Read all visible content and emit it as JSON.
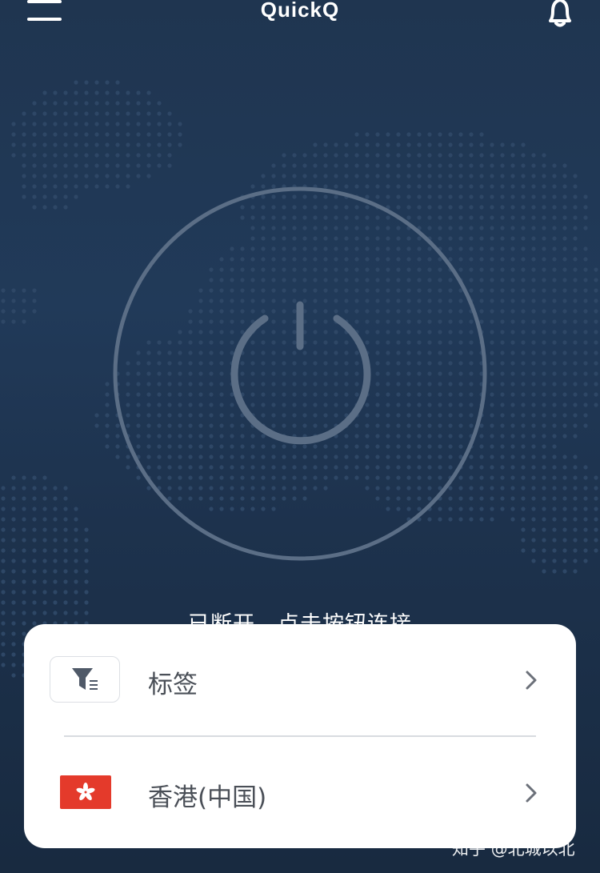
{
  "header": {
    "title": "QuickQ",
    "menu_icon": "hamburger-icon",
    "notification_icon": "bell-icon"
  },
  "main": {
    "power_icon": "power-icon",
    "status_text": "已断开，点击按钮连接"
  },
  "panel": {
    "tag_row": {
      "label": "标签",
      "icon": "filter-icon"
    },
    "region_row": {
      "label": "香港(中国)",
      "icon": "hong-kong-flag-icon"
    }
  },
  "watermark": "知乎 @北城以北",
  "colors": {
    "background_top": "#1f3550",
    "background_bottom": "#182a40",
    "ring": "#5b6e86",
    "panel": "#ffffff",
    "flag_red": "#e43a2b",
    "text_dark": "#4a4f57"
  }
}
